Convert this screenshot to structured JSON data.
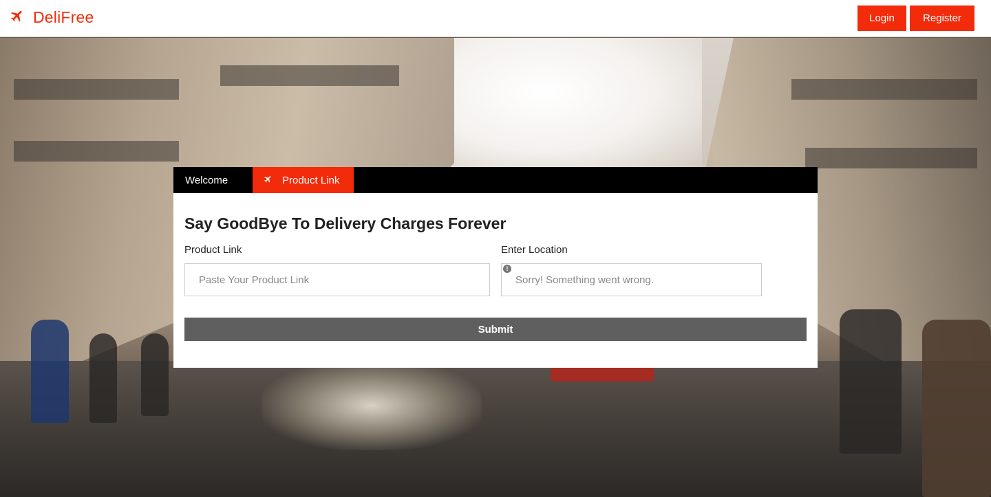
{
  "header": {
    "brand_name": "DeliFree",
    "brand_icon": "airplane-icon",
    "login_label": "Login",
    "register_label": "Register",
    "accent_color": "#f22b0b"
  },
  "card": {
    "tabs": [
      {
        "label": "Welcome"
      },
      {
        "label": "Product Link",
        "icon": "airplane-icon",
        "active": true
      }
    ],
    "headline": "Say GoodBye To Delivery Charges Forever",
    "product_link": {
      "label": "Product Link",
      "placeholder": "Paste Your Product Link"
    },
    "location": {
      "label": "Enter Location",
      "placeholder": "Sorry! Something went wrong.",
      "status_icon": "warning-icon"
    },
    "submit_label": "Submit"
  }
}
